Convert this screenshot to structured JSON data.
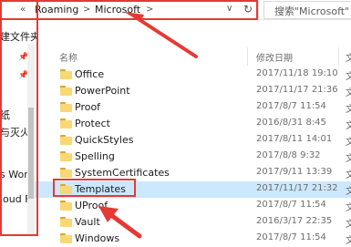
{
  "address": {
    "back_glyph": "«",
    "crumbs": [
      "Roaming",
      "Microsoft"
    ],
    "separator": ">",
    "dropdown_glyph": "∨",
    "refresh_glyph": "↻",
    "search_placeholder": "搜索\"Microsoft\""
  },
  "nav": {
    "items": [
      "建文件夹",
      "纸",
      "与灭火",
      "s Word",
      "loud F"
    ]
  },
  "columns": {
    "name": "名称",
    "date": "修改日期",
    "type": "文"
  },
  "files": [
    {
      "name": "Office",
      "date": "2017/11/18 19:10",
      "type": "文"
    },
    {
      "name": "PowerPoint",
      "date": "2017/11/17 21:36",
      "type": "文"
    },
    {
      "name": "Proof",
      "date": "2017/8/7 11:54",
      "type": "文"
    },
    {
      "name": "Protect",
      "date": "2016/8/31 8:45",
      "type": "文"
    },
    {
      "name": "QuickStyles",
      "date": "2017/8/11 14:01",
      "type": "文"
    },
    {
      "name": "Spelling",
      "date": "2017/8/8 9:32",
      "type": "文"
    },
    {
      "name": "SystemCertificates",
      "date": "2017/9/11 13:39",
      "type": "文"
    },
    {
      "name": "Templates",
      "date": "2017/11/17 21:32",
      "type": "文"
    },
    {
      "name": "UProof",
      "date": "2017/8/7 11:54",
      "type": "文"
    },
    {
      "name": "Vault",
      "date": "2016/3/17 22:35",
      "type": "文"
    },
    {
      "name": "Windows",
      "date": "2017/8/7 11:54",
      "type": "文"
    }
  ],
  "selected_index": 7,
  "colors": {
    "annotation": "#e53935",
    "selection": "#cce8ff",
    "folder": "#f8d775"
  }
}
